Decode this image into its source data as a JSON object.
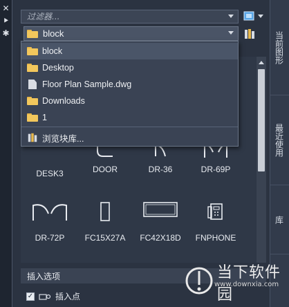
{
  "left_strip": {
    "close": "✕",
    "pin": "⯈",
    "settings": "✱"
  },
  "filter": {
    "placeholder": "过滤器..."
  },
  "folder_select": {
    "value": "block"
  },
  "dropdown": {
    "items": [
      {
        "label": "block",
        "icon": "folder-icon",
        "selected": true
      },
      {
        "label": "Desktop",
        "icon": "folder-icon"
      },
      {
        "label": "Floor Plan Sample.dwg",
        "icon": "document-icon"
      },
      {
        "label": "Downloads",
        "icon": "folder-icon"
      },
      {
        "label": "1",
        "icon": "folder-icon"
      }
    ],
    "browse_label": "浏览块库..."
  },
  "blocks": {
    "row1": [
      "DESK3",
      "DOOR",
      "DR-36",
      "DR-69P"
    ],
    "row2": [
      "DR-72P",
      "FC15X27A",
      "FC42X18D",
      "FNPHONE"
    ]
  },
  "insert_options": {
    "header": "插入选项",
    "insert_point": "插入点"
  },
  "right_tabs": [
    "当前图形",
    "最近使用",
    "库"
  ],
  "watermark": {
    "brand": "当下软件园",
    "url": "www.downxia.com"
  },
  "colors": {
    "panel": "#2f3847",
    "accent_folder": "#f2c75c",
    "selection": "#4a5568"
  }
}
